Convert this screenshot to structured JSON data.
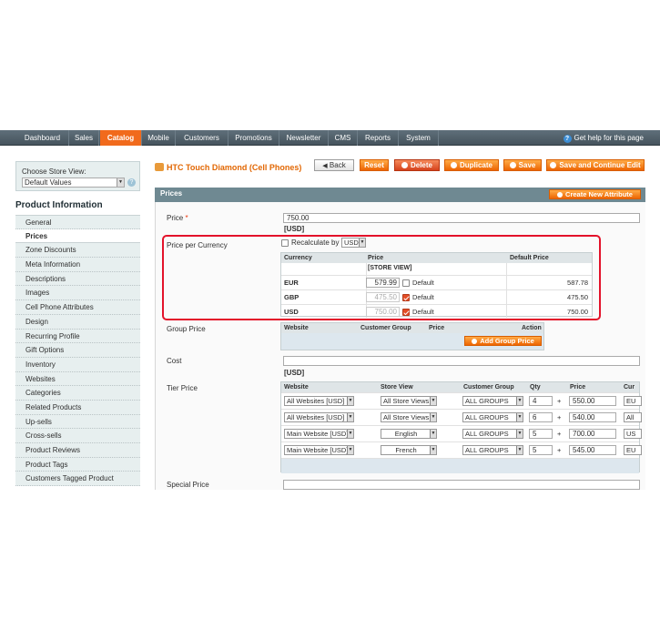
{
  "nav": {
    "items": [
      "Dashboard",
      "Sales",
      "Catalog",
      "Mobile",
      "Customers",
      "Promotions",
      "Newsletter",
      "CMS",
      "Reports",
      "System"
    ],
    "active_index": 2,
    "help": "Get help for this page"
  },
  "store": {
    "label": "Choose Store View:",
    "value": "Default Values"
  },
  "product_info": {
    "title": "Product Information",
    "tabs": [
      "General",
      "Prices",
      "Zone Discounts",
      "Meta Information",
      "Descriptions",
      "Images",
      "Cell Phone Attributes",
      "Design",
      "Recurring Profile",
      "Gift Options",
      "Inventory",
      "Websites",
      "Categories",
      "Related Products",
      "Up-sells",
      "Cross-sells",
      "Product Reviews",
      "Product Tags",
      "Customers Tagged Product"
    ],
    "active_tab": "Prices"
  },
  "header": {
    "title": "HTC Touch Diamond (Cell Phones)",
    "buttons": {
      "back": "Back",
      "reset": "Reset",
      "delete": "Delete",
      "duplicate": "Duplicate",
      "save": "Save",
      "save_continue": "Save and Continue Edit"
    }
  },
  "section": {
    "title": "Prices",
    "create_attribute": "Create New Attribute"
  },
  "price": {
    "label": "Price",
    "required_mark": "*",
    "value": "750.00",
    "unit": "[USD]"
  },
  "price_per_currency": {
    "label": "Price per Currency",
    "recalculate_label": "Recalculate by",
    "recalculate_value": "USD",
    "headers": [
      "Currency",
      "Price",
      "Default Price"
    ],
    "store_view_tag": "[STORE VIEW]",
    "default_label": "Default",
    "rows": [
      {
        "currency": "EUR",
        "price": "579.99",
        "default_checked": false,
        "default_price": "587.78"
      },
      {
        "currency": "GBP",
        "price": "475.50",
        "default_checked": true,
        "default_price": "475.50"
      },
      {
        "currency": "USD",
        "price": "750.00",
        "default_checked": true,
        "default_price": "750.00"
      }
    ]
  },
  "group_price": {
    "label": "Group Price",
    "headers": [
      "Website",
      "Customer Group",
      "Price",
      "Action"
    ],
    "add_button": "Add Group Price"
  },
  "cost": {
    "label": "Cost",
    "unit": "[USD]"
  },
  "tier_price": {
    "label": "Tier Price",
    "headers": [
      "Website",
      "Store View",
      "Customer Group",
      "Qty",
      "Price",
      "Cur"
    ],
    "plus": "+",
    "rows": [
      {
        "website": "All Websites [USD]",
        "store_view": "All Store Views",
        "group": "ALL GROUPS",
        "qty": "4",
        "price": "550.00",
        "currency": "EU"
      },
      {
        "website": "All Websites [USD]",
        "store_view": "All Store Views",
        "group": "ALL GROUPS",
        "qty": "6",
        "price": "540.00",
        "currency": "All"
      },
      {
        "website": "Main Website [USD]",
        "store_view": "English",
        "group": "ALL GROUPS",
        "qty": "5",
        "price": "700.00",
        "currency": "US"
      },
      {
        "website": "Main Website [USD]",
        "store_view": "French",
        "group": "ALL GROUPS",
        "qty": "5",
        "price": "545.00",
        "currency": "EU"
      }
    ]
  },
  "special_price": {
    "label": "Special Price"
  }
}
